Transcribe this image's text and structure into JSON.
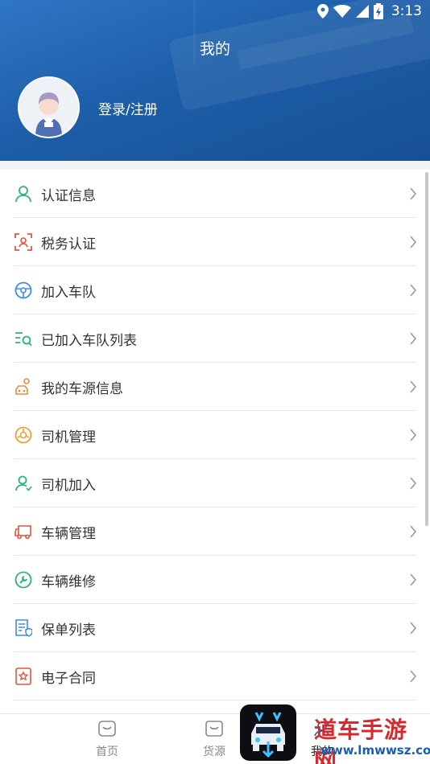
{
  "status_bar": {
    "time": "3:13"
  },
  "header": {
    "title": "我的",
    "login_label": "登录/注册"
  },
  "menu": [
    {
      "label": "认证信息",
      "icon": "person-outline-icon",
      "color": "#2bb673"
    },
    {
      "label": "税务认证",
      "icon": "face-scan-icon",
      "color": "#e5533d"
    },
    {
      "label": "加入车队",
      "icon": "steering-wheel-icon",
      "color": "#3a8ee6"
    },
    {
      "label": "已加入车队列表",
      "icon": "list-search-icon",
      "color": "#2bb673"
    },
    {
      "label": "我的车源信息",
      "icon": "car-person-icon",
      "color": "#f08a3c"
    },
    {
      "label": "司机管理",
      "icon": "wheel-icon",
      "color": "#f0a030"
    },
    {
      "label": "司机加入",
      "icon": "person-add-icon",
      "color": "#2bb673"
    },
    {
      "label": "车辆管理",
      "icon": "truck-icon",
      "color": "#e5533d"
    },
    {
      "label": "车辆维修",
      "icon": "wrench-icon",
      "color": "#2bb673"
    },
    {
      "label": "保单列表",
      "icon": "policy-doc-icon",
      "color": "#3a8ee6"
    },
    {
      "label": "电子合同",
      "icon": "contract-icon",
      "color": "#e5533d"
    }
  ],
  "bottom_nav": [
    {
      "label": "首页",
      "icon": "home-icon"
    },
    {
      "label": "货源",
      "icon": "cargo-icon"
    },
    {
      "label": "我的",
      "icon": "profile-icon"
    }
  ],
  "watermark": {
    "title": "道车手游网",
    "url": "www.lmwwsz.com"
  }
}
